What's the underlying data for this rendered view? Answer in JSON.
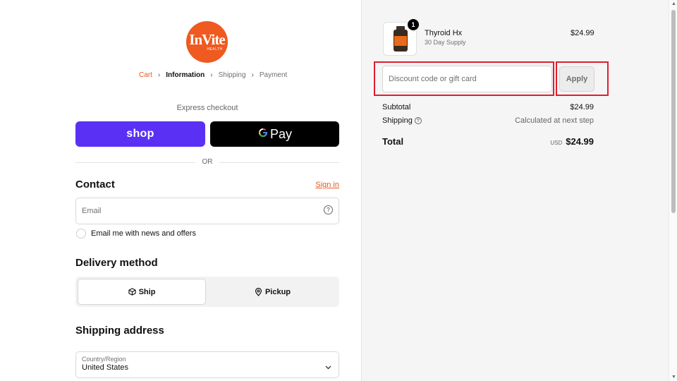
{
  "brand": {
    "logo_text": "InVite",
    "logo_sub": "HEALTH",
    "accent_color": "#e55a1d"
  },
  "breadcrumb": {
    "items": [
      "Cart",
      "Information",
      "Shipping",
      "Payment"
    ],
    "active": "Information"
  },
  "express": {
    "label": "Express checkout",
    "shop_label": "shop",
    "gpay_label": "Pay",
    "or_label": "OR"
  },
  "contact": {
    "heading": "Contact",
    "signin_label": "Sign in",
    "email_placeholder": "Email",
    "newsletter_label": "Email me with news and offers"
  },
  "delivery": {
    "heading": "Delivery method",
    "options": [
      "Ship",
      "Pickup"
    ],
    "selected": "Ship"
  },
  "shipping_address": {
    "heading": "Shipping address",
    "country_label": "Country/Region",
    "country_value": "United States"
  },
  "order": {
    "product": {
      "name": "Thyroid Hx",
      "subtitle": "30 Day Supply",
      "price": "$24.99",
      "quantity": "1"
    },
    "discount_placeholder": "Discount code or gift card",
    "apply_label": "Apply",
    "subtotal_label": "Subtotal",
    "subtotal_value": "$24.99",
    "shipping_label": "Shipping",
    "shipping_value": "Calculated at next step",
    "total_label": "Total",
    "currency": "USD",
    "total_value": "$24.99"
  }
}
